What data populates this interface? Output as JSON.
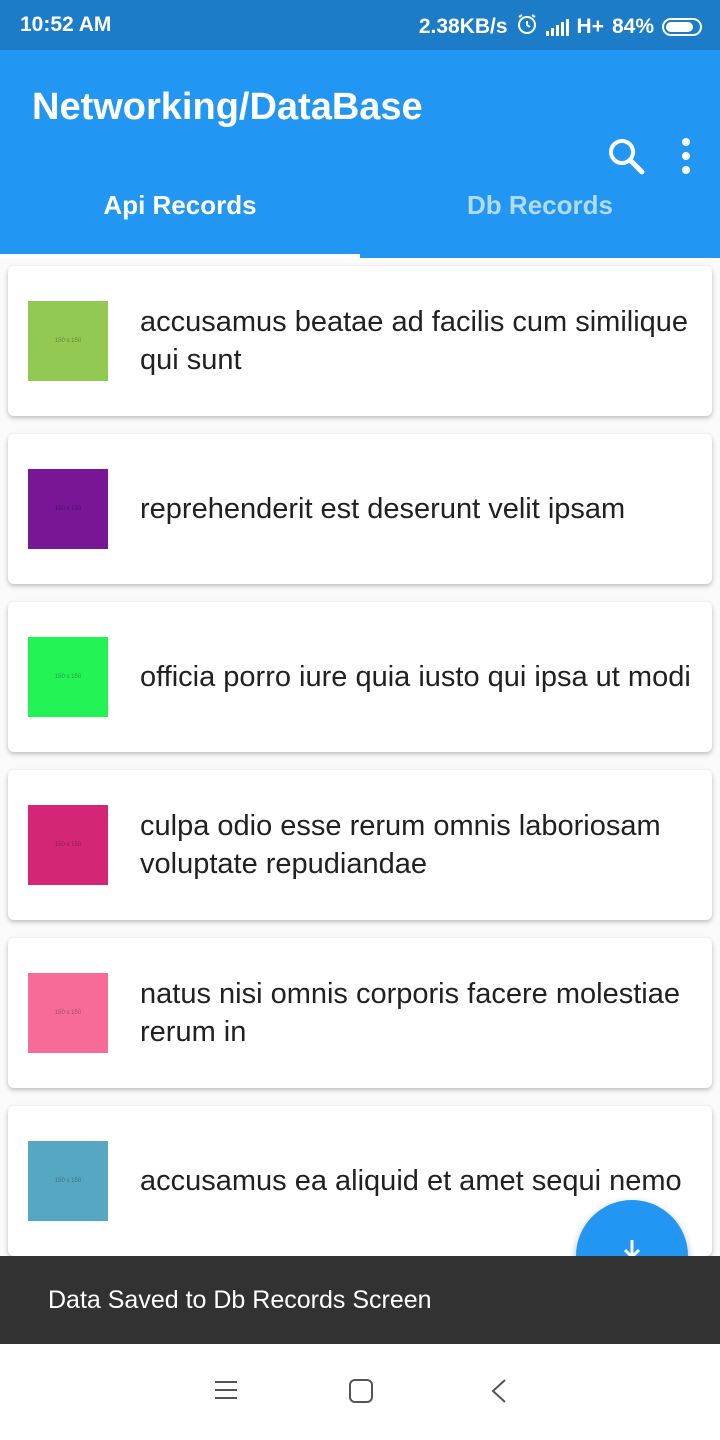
{
  "status_bar": {
    "time": "10:52 AM",
    "speed": "2.38KB/s",
    "network": "H+",
    "battery_text": "84%",
    "battery_level": 0.84,
    "icons": [
      "alarm-icon",
      "signal-icon",
      "battery-icon"
    ]
  },
  "app_bar": {
    "title": "Networking/DataBase",
    "color": "#2196f3",
    "actions": [
      "search-icon",
      "more-vert-icon"
    ]
  },
  "tabs": [
    {
      "label": "Api Records",
      "selected": true
    },
    {
      "label": "Db Records",
      "selected": false
    }
  ],
  "records": [
    {
      "text": "accusamus beatae ad facilis cum similique qui sunt",
      "thumb_color": "#92c952",
      "thumb_label": "150 x 150"
    },
    {
      "text": "reprehenderit est deserunt velit ipsam",
      "thumb_color": "#771796",
      "thumb_label": "150 x 150"
    },
    {
      "text": "officia porro iure quia iusto qui ipsa ut modi",
      "thumb_color": "#24f355",
      "thumb_label": "150 x 150"
    },
    {
      "text": "culpa odio esse rerum omnis laboriosam voluptate repudiandae",
      "thumb_color": "#d32776",
      "thumb_label": "150 x 150"
    },
    {
      "text": "natus nisi omnis corporis facere molestiae rerum in",
      "thumb_color": "#f66b97",
      "thumb_label": "150 x 150"
    },
    {
      "text": "accusamus ea aliquid et amet sequi nemo",
      "thumb_color": "#56a8c2",
      "thumb_label": "150 x 150"
    }
  ],
  "fab": {
    "icon": "download-icon",
    "color": "#2196f3"
  },
  "snackbar": {
    "message": "Data Saved to  Db Records Screen"
  },
  "nav_bar": {
    "icons": [
      "menu-icon",
      "home-icon",
      "back-icon"
    ]
  }
}
